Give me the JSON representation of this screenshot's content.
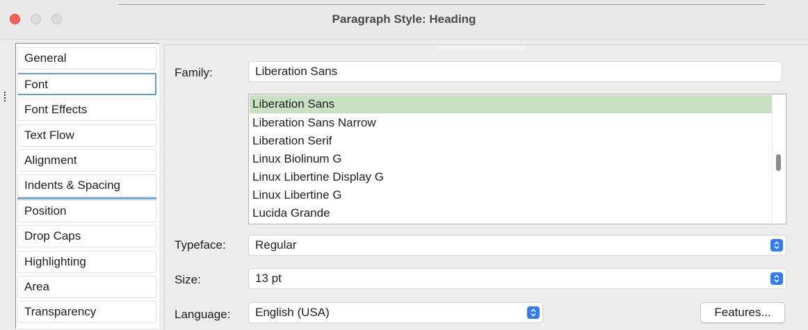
{
  "window": {
    "title": "Paragraph Style: Heading"
  },
  "sidebar": {
    "items": [
      {
        "label": "General"
      },
      {
        "label": "Font"
      },
      {
        "label": "Font Effects"
      },
      {
        "label": "Text Flow"
      },
      {
        "label": "Alignment"
      },
      {
        "label": "Indents & Spacing"
      },
      {
        "label": "Position"
      },
      {
        "label": "Drop Caps"
      },
      {
        "label": "Highlighting"
      },
      {
        "label": "Area"
      },
      {
        "label": "Transparency"
      }
    ],
    "selected": "Font"
  },
  "font": {
    "family_label": "Family:",
    "family_value": "Liberation Sans",
    "family_list": [
      "Liberation Sans",
      "Liberation Sans Narrow",
      "Liberation Serif",
      "Linux Biolinum G",
      "Linux Libertine Display G",
      "Linux Libertine G",
      "Lucida Grande"
    ],
    "typeface_label": "Typeface:",
    "typeface_value": "Regular",
    "size_label": "Size:",
    "size_value": "13 pt",
    "language_label": "Language:",
    "language_value": "English (USA)",
    "features_button": "Features..."
  },
  "colors": {
    "accent": "#2f7cf6",
    "selection": "#c9e1c3",
    "close": "#ff5f57"
  }
}
